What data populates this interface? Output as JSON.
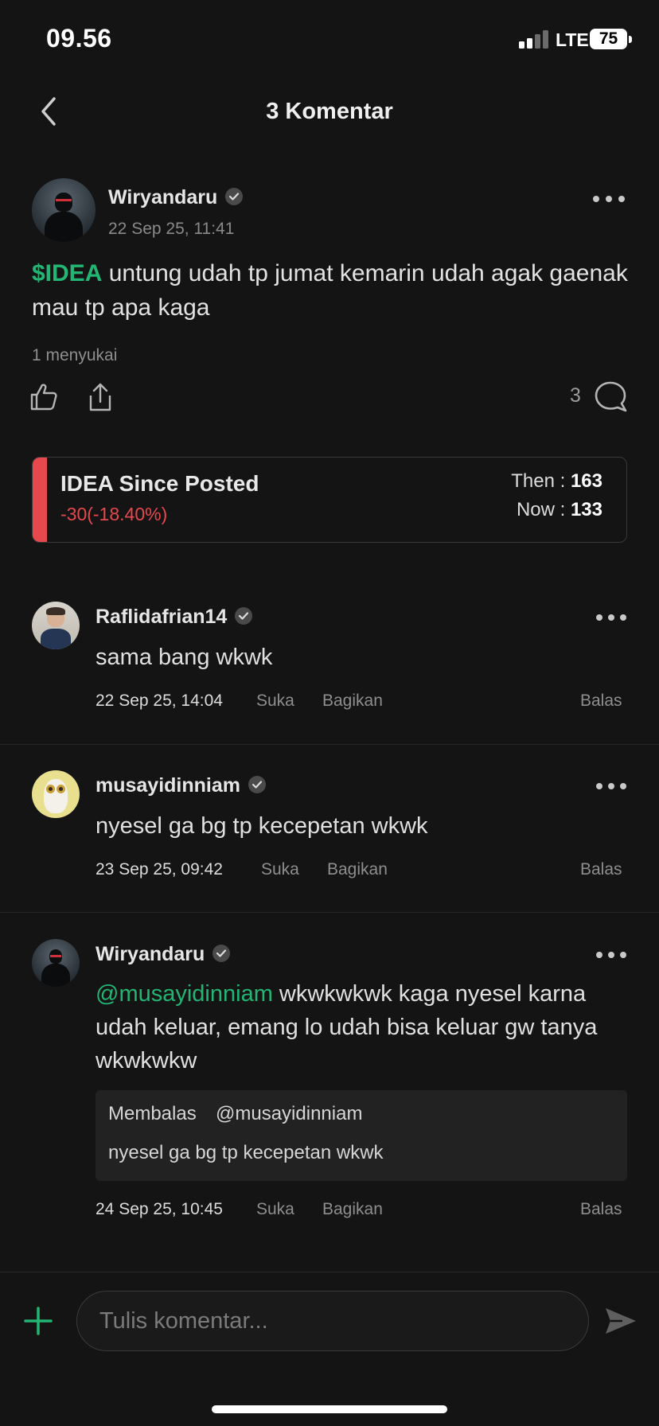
{
  "status_bar": {
    "time": "09.56",
    "network": "LTE",
    "battery": "75"
  },
  "header": {
    "title": "3 Komentar"
  },
  "post": {
    "username": "Wiryandaru",
    "timestamp": "22 Sep 25, 11:41",
    "ticker": "$IDEA",
    "text": " untung udah tp jumat kemarin udah agak gaenak mau tp apa kaga",
    "likes": "1 menyukai",
    "comment_count": "3"
  },
  "performance": {
    "title": "IDEA Since Posted",
    "change": "-30(-18.40%)",
    "then_label": "Then : ",
    "then_value": "163",
    "now_label": "Now : ",
    "now_value": "133",
    "accent_color": "#e5484d"
  },
  "comments": [
    {
      "username": "Raflidafrian14",
      "text": "sama bang wkwk",
      "timestamp": "22 Sep 25, 14:04",
      "like_label": "Suka",
      "share_label": "Bagikan",
      "reply_label": "Balas"
    },
    {
      "username": "musayidinniam",
      "text": "nyesel ga bg tp kecepetan wkwk",
      "timestamp": "23 Sep 25, 09:42",
      "like_label": "Suka",
      "share_label": "Bagikan",
      "reply_label": "Balas"
    },
    {
      "username": "Wiryandaru",
      "mention": "@musayidinniam",
      "text": " wkwkwkwk kaga nyesel karna udah keluar, emang lo udah bisa keluar gw tanya wkwkwkw",
      "reply_prefix": "Membalas",
      "reply_target": "@musayidinniam",
      "reply_body": "nyesel ga bg tp kecepetan wkwk",
      "timestamp": "24 Sep 25, 10:45",
      "like_label": "Suka",
      "share_label": "Bagikan",
      "reply_label": "Balas"
    }
  ],
  "composer": {
    "placeholder": "Tulis komentar..."
  },
  "colors": {
    "accent_green": "#22b573",
    "negative_red": "#e5484d",
    "background": "#141414"
  },
  "icons": [
    "chevron-left-icon",
    "verified-icon",
    "more-icon",
    "thumbs-up-icon",
    "share-icon",
    "comment-bubble-icon",
    "plus-icon",
    "send-icon"
  ]
}
